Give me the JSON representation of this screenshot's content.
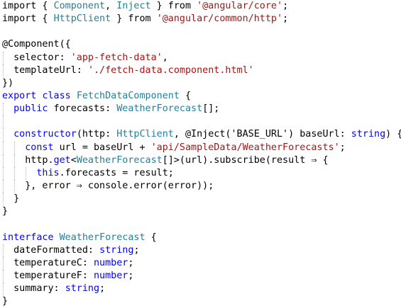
{
  "editor": {
    "language": "typescript",
    "colors": {
      "keyword": "#0000ff",
      "type": "#267f99",
      "string": "#a31515",
      "plain": "#000000",
      "background": "#ffffff"
    },
    "lines": [
      [
        {
          "t": "import",
          "c": "plain"
        },
        {
          "t": " { ",
          "c": "plain"
        },
        {
          "t": "Component",
          "c": "type"
        },
        {
          "t": ", ",
          "c": "plain"
        },
        {
          "t": "Inject",
          "c": "type"
        },
        {
          "t": " } from ",
          "c": "plain"
        },
        {
          "t": "'@angular/core'",
          "c": "string"
        },
        {
          "t": ";",
          "c": "plain"
        }
      ],
      [
        {
          "t": "import",
          "c": "plain"
        },
        {
          "t": " { ",
          "c": "plain"
        },
        {
          "t": "HttpClient",
          "c": "type"
        },
        {
          "t": " } from ",
          "c": "plain"
        },
        {
          "t": "'@angular/common/http'",
          "c": "string"
        },
        {
          "t": ";",
          "c": "plain"
        }
      ],
      [],
      [
        {
          "t": "@Component({",
          "c": "plain"
        }
      ],
      [
        {
          "t": "  selector: ",
          "c": "plain"
        },
        {
          "t": "'app-fetch-data'",
          "c": "string"
        },
        {
          "t": ",",
          "c": "plain"
        }
      ],
      [
        {
          "t": "  templateUrl: ",
          "c": "plain"
        },
        {
          "t": "'./fetch-data.component.html'",
          "c": "string"
        }
      ],
      [
        {
          "t": "})",
          "c": "plain"
        }
      ],
      [
        {
          "t": "export",
          "c": "keyword"
        },
        {
          "t": " ",
          "c": "plain"
        },
        {
          "t": "class",
          "c": "keyword"
        },
        {
          "t": " ",
          "c": "plain"
        },
        {
          "t": "FetchDataComponent",
          "c": "type"
        },
        {
          "t": " {",
          "c": "plain"
        }
      ],
      [
        {
          "t": "  ",
          "c": "plain"
        },
        {
          "t": "public",
          "c": "keyword"
        },
        {
          "t": " forecasts: ",
          "c": "plain"
        },
        {
          "t": "WeatherForecast",
          "c": "type"
        },
        {
          "t": "[];",
          "c": "plain"
        }
      ],
      [],
      [
        {
          "t": "  ",
          "c": "plain"
        },
        {
          "t": "constructor",
          "c": "keyword"
        },
        {
          "t": "(http: ",
          "c": "plain"
        },
        {
          "t": "HttpClient",
          "c": "type"
        },
        {
          "t": ", @Inject('BASE_URL') baseUrl: ",
          "c": "plain"
        },
        {
          "t": "string",
          "c": "keyword"
        },
        {
          "t": ") {",
          "c": "plain"
        }
      ],
      [
        {
          "t": "    ",
          "c": "plain"
        },
        {
          "t": "const",
          "c": "keyword"
        },
        {
          "t": " url = baseUrl + ",
          "c": "plain"
        },
        {
          "t": "'api/SampleData/WeatherForecasts'",
          "c": "string"
        },
        {
          "t": ";",
          "c": "plain"
        }
      ],
      [
        {
          "t": "    http.",
          "c": "plain"
        },
        {
          "t": "get",
          "c": "keyword"
        },
        {
          "t": "<",
          "c": "plain"
        },
        {
          "t": "WeatherForecast",
          "c": "type"
        },
        {
          "t": "[]>(url).subscribe(result ⇒ {",
          "c": "plain"
        }
      ],
      [
        {
          "t": "      ",
          "c": "plain"
        },
        {
          "t": "this",
          "c": "keyword"
        },
        {
          "t": ".forecasts = result;",
          "c": "plain"
        }
      ],
      [
        {
          "t": "    }, error ⇒ console.error(error));",
          "c": "plain"
        }
      ],
      [
        {
          "t": "  }",
          "c": "plain"
        }
      ],
      [
        {
          "t": "}",
          "c": "plain"
        }
      ],
      [],
      [
        {
          "t": "interface",
          "c": "keyword"
        },
        {
          "t": " ",
          "c": "plain"
        },
        {
          "t": "WeatherForecast",
          "c": "type"
        },
        {
          "t": " {",
          "c": "plain"
        }
      ],
      [
        {
          "t": "  dateFormatted: ",
          "c": "plain"
        },
        {
          "t": "string",
          "c": "keyword"
        },
        {
          "t": ";",
          "c": "plain"
        }
      ],
      [
        {
          "t": "  temperatureC: ",
          "c": "plain"
        },
        {
          "t": "number",
          "c": "keyword"
        },
        {
          "t": ";",
          "c": "plain"
        }
      ],
      [
        {
          "t": "  temperatureF: ",
          "c": "plain"
        },
        {
          "t": "number",
          "c": "keyword"
        },
        {
          "t": ";",
          "c": "plain"
        }
      ],
      [
        {
          "t": "  summary: ",
          "c": "plain"
        },
        {
          "t": "string",
          "c": "keyword"
        },
        {
          "t": ";",
          "c": "plain"
        }
      ],
      [
        {
          "t": "}",
          "c": "plain"
        }
      ]
    ]
  }
}
